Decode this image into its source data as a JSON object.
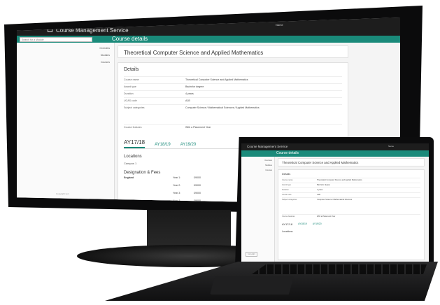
{
  "colors": {
    "accent": "#1a8a7a",
    "topbar": "#1d1d1d",
    "bezel": "#0b0b0c"
  },
  "desktop": {
    "app_title": "Course Management Service",
    "user_label": "Name",
    "section_title": "Course details",
    "search_placeholder": "Search for a Module",
    "nav": [
      "Overview",
      "Modules",
      "Courses"
    ],
    "sidebar_footer": "Copyright text",
    "course_title": "Theoretical Computer Science and Applied Mathematics",
    "details_heading": "Details",
    "fields": [
      {
        "label": "Course name",
        "value": "Theoretical Computer Science and Applied Mathematics"
      },
      {
        "label": "Award type",
        "value": "Bachelor degree"
      },
      {
        "label": "Duration",
        "value": "4 years"
      },
      {
        "label": "UCAS code",
        "value": "A1B"
      },
      {
        "label": "Subject categories",
        "value": "Computer Science / Mathematical Sciences / Applied Mathematics"
      },
      {
        "label": "Course features",
        "value": "With a Placement Year"
      }
    ],
    "tabs": [
      "AY17/18",
      "AY18/19",
      "AY19/20"
    ],
    "locations_heading": "Locations",
    "location_item": "Campus 1",
    "fees_heading": "Designation & Fees",
    "fee_rows": [
      {
        "region": "England",
        "year": "Year 1:",
        "fee": "£9000"
      },
      {
        "region": "",
        "year": "Year 2:",
        "fee": "£9000"
      },
      {
        "region": "",
        "year": "Year 3:",
        "fee": "£9000"
      },
      {
        "region": "",
        "year": "Year 4:",
        "fee": "£9000"
      }
    ]
  },
  "laptop": {
    "app_title": "Course Management Service",
    "user_label": "Name",
    "section_title": "Course details",
    "nav": [
      "Overview",
      "Modules",
      "Courses"
    ],
    "sidebar_button": "Copyright",
    "course_title": "Theoretical Computer Science and Applied Mathematics",
    "details_heading": "Details",
    "fields": [
      {
        "label": "Course name",
        "value": "Theoretical Computer Science and Applied Mathematics"
      },
      {
        "label": "Award type",
        "value": "Bachelor degree"
      },
      {
        "label": "Duration",
        "value": "4 years"
      },
      {
        "label": "UCAS code",
        "value": "A1B"
      },
      {
        "label": "Subject categories",
        "value": "Computer Science / Mathematical Sciences"
      },
      {
        "label": "Course features",
        "value": "With a Placement Year"
      }
    ],
    "tabs": [
      "AY17/18",
      "AY18/19",
      "AY19/20"
    ],
    "locations_heading": "Locations"
  }
}
